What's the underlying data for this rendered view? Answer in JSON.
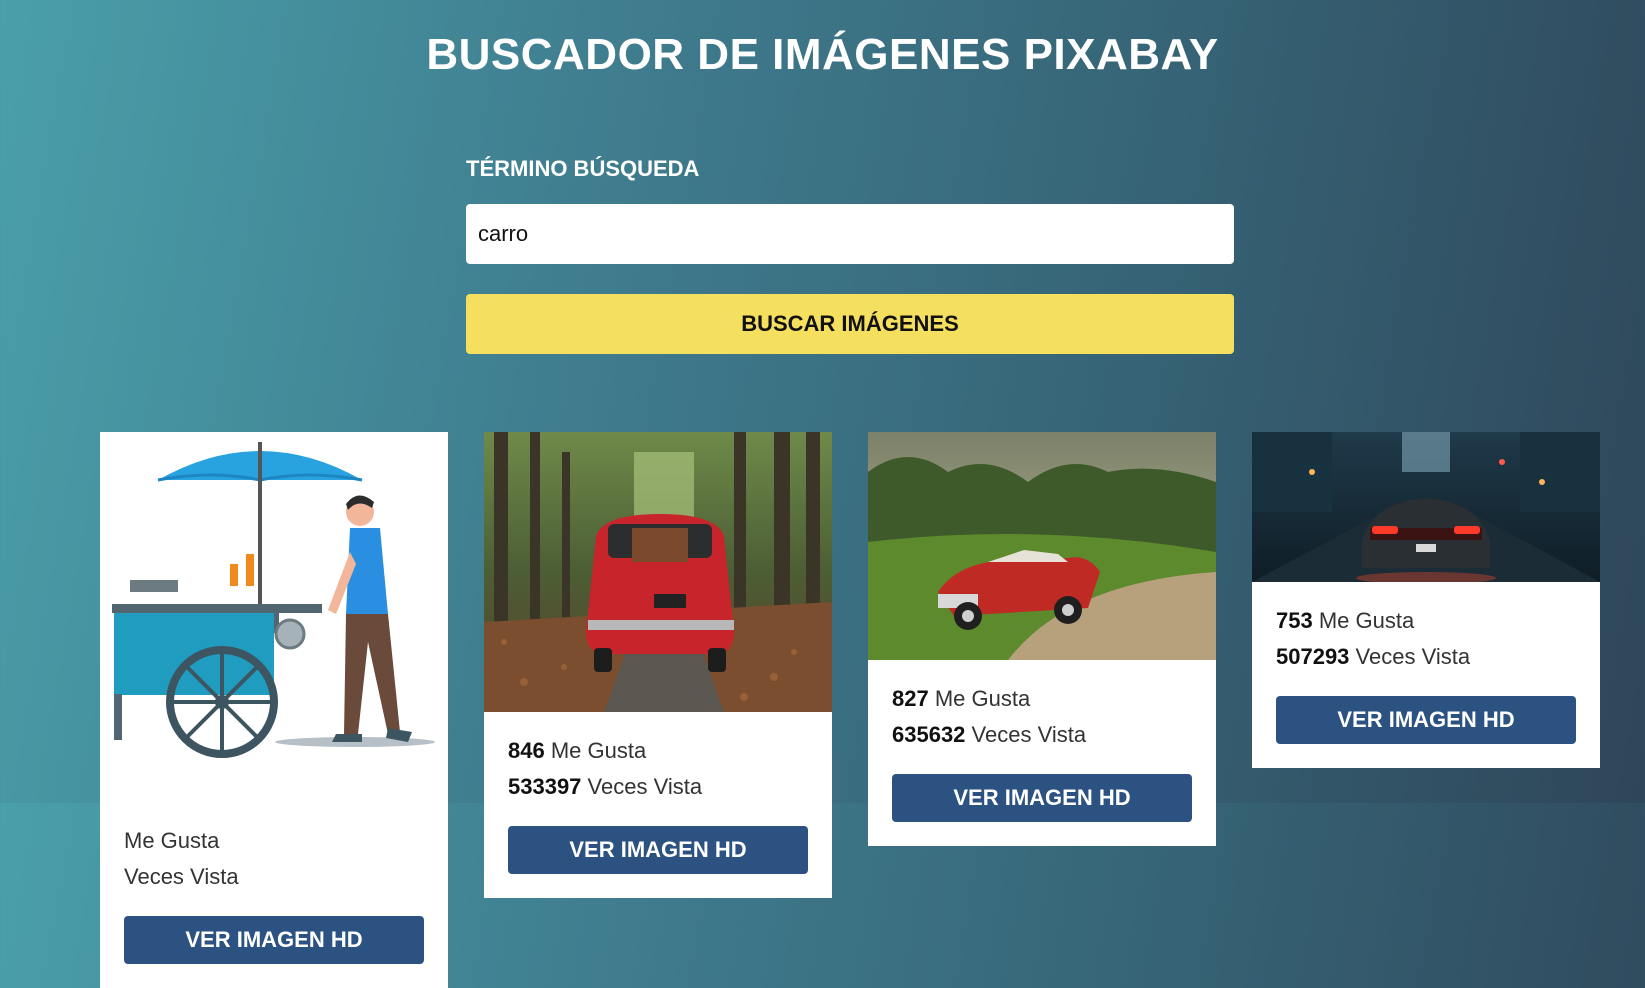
{
  "header": {
    "title": "BUSCADOR DE IMÁGENES PIXABAY"
  },
  "search": {
    "label": "TÉRMINO BÚSQUEDA",
    "value": "carro",
    "button_label": "BUSCAR IMÁGENES"
  },
  "results": [
    {
      "image_icon": "street-vendor-cart-illustration",
      "likes": "",
      "likes_label": "Me Gusta",
      "views": "",
      "views_label": "Veces Vista",
      "button_label": "VER IMAGEN HD"
    },
    {
      "image_icon": "red-vintage-car-forest-photo",
      "likes": "846",
      "likes_label": "Me Gusta",
      "views": "533397",
      "views_label": "Veces Vista",
      "button_label": "VER IMAGEN HD"
    },
    {
      "image_icon": "red-classic-convertible-photo",
      "likes": "827",
      "likes_label": "Me Gusta",
      "views": "635632",
      "views_label": "Veces Vista",
      "button_label": "VER IMAGEN HD"
    },
    {
      "image_icon": "sports-car-rainy-street-photo",
      "likes": "753",
      "likes_label": "Me Gusta",
      "views": "507293",
      "views_label": "Veces Vista",
      "button_label": "VER IMAGEN HD"
    }
  ],
  "colors": {
    "accent_yellow": "#f5df5f",
    "button_blue": "#2c5282"
  }
}
